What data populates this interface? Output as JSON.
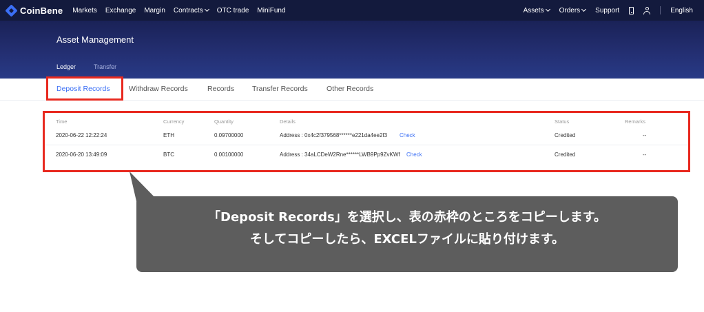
{
  "nav": {
    "brand": "CoinBene",
    "left_items": [
      "Markets",
      "Exchange",
      "Margin",
      "Contracts",
      "OTC trade",
      "MiniFund"
    ],
    "assets": "Assets",
    "orders": "Orders",
    "support": "Support",
    "language": "English"
  },
  "header": {
    "title": "Asset Management",
    "subtabs": [
      "Ledger",
      "Transfer"
    ]
  },
  "tabs": [
    "Deposit Records",
    "Withdraw Records",
    "Records",
    "Transfer Records",
    "Other Records"
  ],
  "table": {
    "columns": [
      "Time",
      "Currency",
      "Quantity",
      "Details",
      "Status",
      "Remarks"
    ],
    "rows": [
      {
        "time": "2020-06-22 12:22:24",
        "currency": "ETH",
        "quantity": "0.09700000",
        "details": "Address : 0x4c2f379568******e221da4ee2f3",
        "check": "Check",
        "status": "Credited",
        "remarks": "--"
      },
      {
        "time": "2020-06-20 13:49:09",
        "currency": "BTC",
        "quantity": "0.00100000",
        "details": "Address : 34aLCDeW2Rne******LWB9Pp9ZvKWf",
        "check": "Check",
        "status": "Credited",
        "remarks": "--"
      }
    ]
  },
  "callout": {
    "line1": "「Deposit Records」を選択し、表の赤枠のところをコピーします。",
    "line2": "そしてコピーしたら、EXCELファイルに貼り付けます。"
  },
  "colors": {
    "accent": "#3b6ff5",
    "highlight": "#e8291f",
    "nav_bg": "#131a3d",
    "callout_bg": "#5d5d5d"
  }
}
